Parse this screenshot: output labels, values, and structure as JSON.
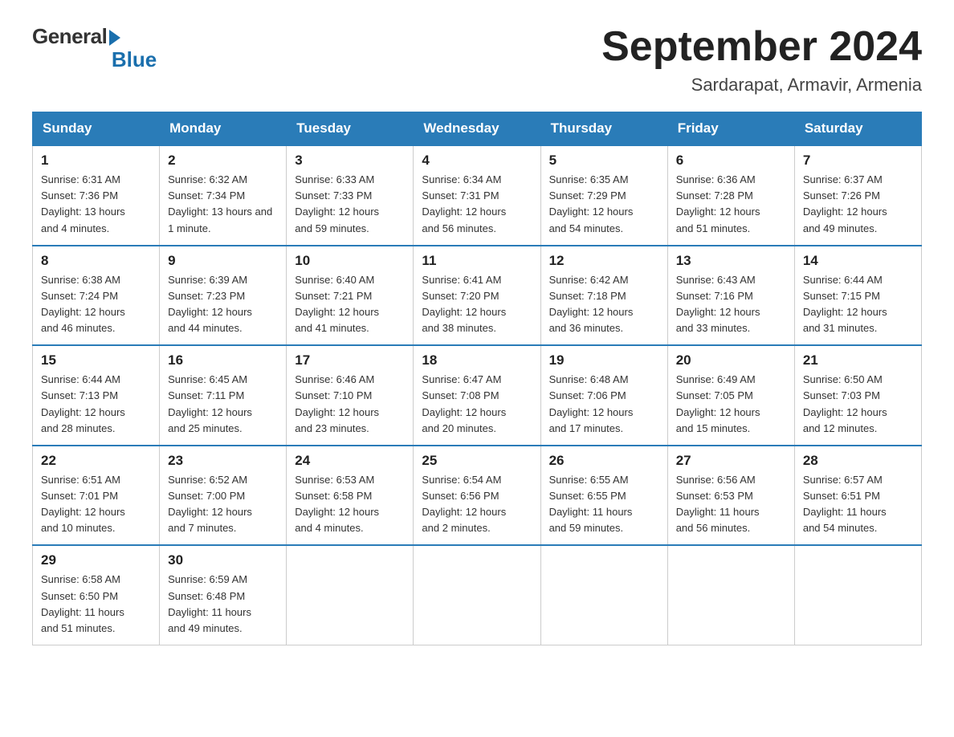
{
  "logo": {
    "general": "General",
    "blue": "Blue"
  },
  "header": {
    "month": "September 2024",
    "location": "Sardarapat, Armavir, Armenia"
  },
  "weekdays": [
    "Sunday",
    "Monday",
    "Tuesday",
    "Wednesday",
    "Thursday",
    "Friday",
    "Saturday"
  ],
  "weeks": [
    [
      {
        "day": "1",
        "sunrise": "6:31 AM",
        "sunset": "7:36 PM",
        "daylight": "13 hours and 4 minutes."
      },
      {
        "day": "2",
        "sunrise": "6:32 AM",
        "sunset": "7:34 PM",
        "daylight": "13 hours and 1 minute."
      },
      {
        "day": "3",
        "sunrise": "6:33 AM",
        "sunset": "7:33 PM",
        "daylight": "12 hours and 59 minutes."
      },
      {
        "day": "4",
        "sunrise": "6:34 AM",
        "sunset": "7:31 PM",
        "daylight": "12 hours and 56 minutes."
      },
      {
        "day": "5",
        "sunrise": "6:35 AM",
        "sunset": "7:29 PM",
        "daylight": "12 hours and 54 minutes."
      },
      {
        "day": "6",
        "sunrise": "6:36 AM",
        "sunset": "7:28 PM",
        "daylight": "12 hours and 51 minutes."
      },
      {
        "day": "7",
        "sunrise": "6:37 AM",
        "sunset": "7:26 PM",
        "daylight": "12 hours and 49 minutes."
      }
    ],
    [
      {
        "day": "8",
        "sunrise": "6:38 AM",
        "sunset": "7:24 PM",
        "daylight": "12 hours and 46 minutes."
      },
      {
        "day": "9",
        "sunrise": "6:39 AM",
        "sunset": "7:23 PM",
        "daylight": "12 hours and 44 minutes."
      },
      {
        "day": "10",
        "sunrise": "6:40 AM",
        "sunset": "7:21 PM",
        "daylight": "12 hours and 41 minutes."
      },
      {
        "day": "11",
        "sunrise": "6:41 AM",
        "sunset": "7:20 PM",
        "daylight": "12 hours and 38 minutes."
      },
      {
        "day": "12",
        "sunrise": "6:42 AM",
        "sunset": "7:18 PM",
        "daylight": "12 hours and 36 minutes."
      },
      {
        "day": "13",
        "sunrise": "6:43 AM",
        "sunset": "7:16 PM",
        "daylight": "12 hours and 33 minutes."
      },
      {
        "day": "14",
        "sunrise": "6:44 AM",
        "sunset": "7:15 PM",
        "daylight": "12 hours and 31 minutes."
      }
    ],
    [
      {
        "day": "15",
        "sunrise": "6:44 AM",
        "sunset": "7:13 PM",
        "daylight": "12 hours and 28 minutes."
      },
      {
        "day": "16",
        "sunrise": "6:45 AM",
        "sunset": "7:11 PM",
        "daylight": "12 hours and 25 minutes."
      },
      {
        "day": "17",
        "sunrise": "6:46 AM",
        "sunset": "7:10 PM",
        "daylight": "12 hours and 23 minutes."
      },
      {
        "day": "18",
        "sunrise": "6:47 AM",
        "sunset": "7:08 PM",
        "daylight": "12 hours and 20 minutes."
      },
      {
        "day": "19",
        "sunrise": "6:48 AM",
        "sunset": "7:06 PM",
        "daylight": "12 hours and 17 minutes."
      },
      {
        "day": "20",
        "sunrise": "6:49 AM",
        "sunset": "7:05 PM",
        "daylight": "12 hours and 15 minutes."
      },
      {
        "day": "21",
        "sunrise": "6:50 AM",
        "sunset": "7:03 PM",
        "daylight": "12 hours and 12 minutes."
      }
    ],
    [
      {
        "day": "22",
        "sunrise": "6:51 AM",
        "sunset": "7:01 PM",
        "daylight": "12 hours and 10 minutes."
      },
      {
        "day": "23",
        "sunrise": "6:52 AM",
        "sunset": "7:00 PM",
        "daylight": "12 hours and 7 minutes."
      },
      {
        "day": "24",
        "sunrise": "6:53 AM",
        "sunset": "6:58 PM",
        "daylight": "12 hours and 4 minutes."
      },
      {
        "day": "25",
        "sunrise": "6:54 AM",
        "sunset": "6:56 PM",
        "daylight": "12 hours and 2 minutes."
      },
      {
        "day": "26",
        "sunrise": "6:55 AM",
        "sunset": "6:55 PM",
        "daylight": "11 hours and 59 minutes."
      },
      {
        "day": "27",
        "sunrise": "6:56 AM",
        "sunset": "6:53 PM",
        "daylight": "11 hours and 56 minutes."
      },
      {
        "day": "28",
        "sunrise": "6:57 AM",
        "sunset": "6:51 PM",
        "daylight": "11 hours and 54 minutes."
      }
    ],
    [
      {
        "day": "29",
        "sunrise": "6:58 AM",
        "sunset": "6:50 PM",
        "daylight": "11 hours and 51 minutes."
      },
      {
        "day": "30",
        "sunrise": "6:59 AM",
        "sunset": "6:48 PM",
        "daylight": "11 hours and 49 minutes."
      },
      null,
      null,
      null,
      null,
      null
    ]
  ],
  "labels": {
    "sunrise": "Sunrise:",
    "sunset": "Sunset:",
    "daylight": "Daylight:"
  }
}
